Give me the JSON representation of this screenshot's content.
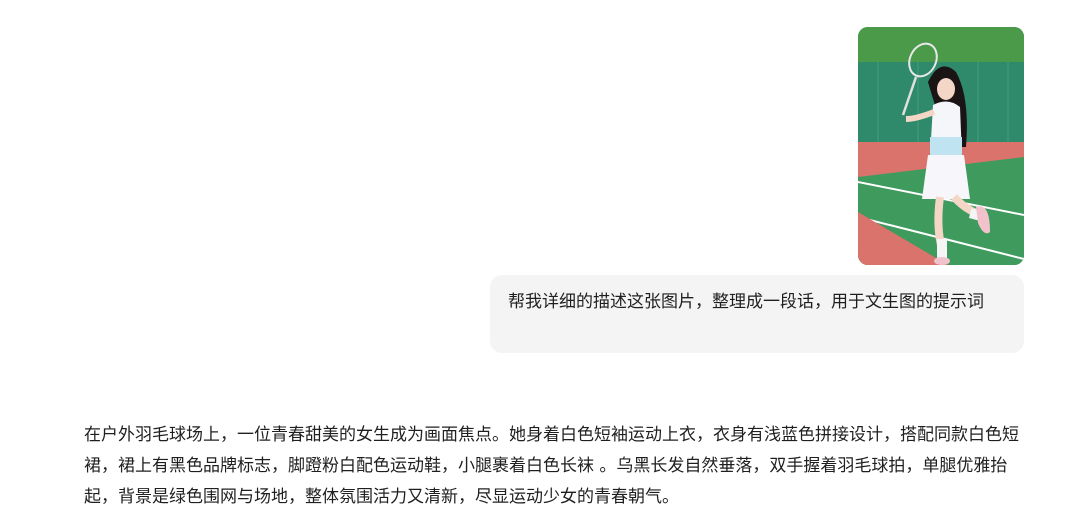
{
  "conversation": {
    "user_image": {
      "icon": "photo-badminton-girl"
    },
    "user_message": "帮我详细的描述这张图片，整理成一段话，用于文生图的提示词",
    "assistant_reply": "在户外羽毛球场上，一位青春甜美的女生成为画面焦点。她身着白色短袖运动上衣，衣身有浅蓝色拼接设计，搭配同款白色短裙，裙上有黑色品牌标志，脚蹬粉白配色运动鞋，小腿裹着白色长袜 。乌黑长发自然垂落，双手握着羽毛球拍，单腿优雅抬起，背景是绿色围网与场地，整体氛围活力又清新，尽显运动少女的青春朝气。"
  },
  "colors": {
    "bubble_bg": "#f4f4f4",
    "text": "#1f1f1f",
    "court_green": "#3f9a5e",
    "court_red": "#d9736b"
  }
}
